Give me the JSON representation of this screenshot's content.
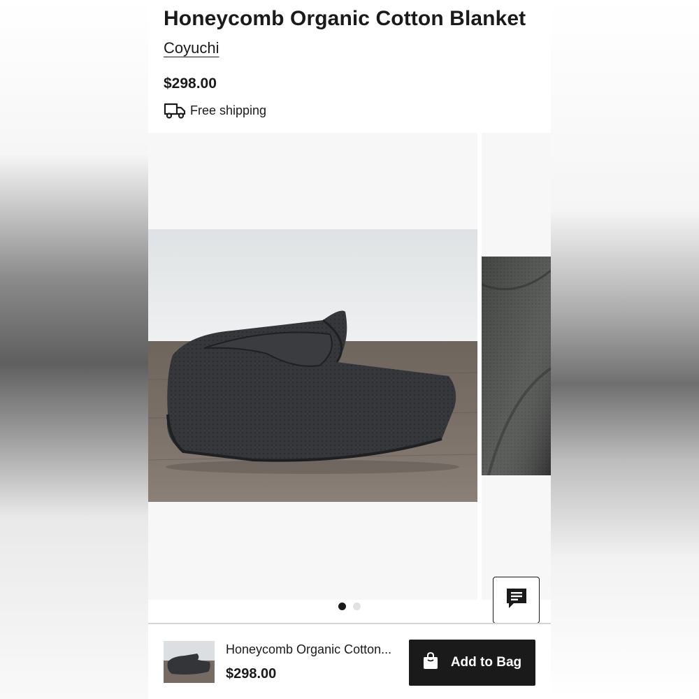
{
  "product": {
    "title": "Honeycomb Organic Cotton Blanket",
    "brand": "Coyuchi",
    "price": "$298.00",
    "shipping": "Free shipping"
  },
  "carousel": {
    "slide_count": 2,
    "active_index": 0
  },
  "sticky_bar": {
    "name": "Honeycomb Organic Cotton...",
    "price": "$298.00",
    "add_to_bag_label": "Add to Bag"
  },
  "icons": {
    "shipping": "truck-icon",
    "chat": "chat-icon",
    "bag": "shopping-bag-icon"
  },
  "colors": {
    "text": "#1a1a1a",
    "button_bg": "#1a1a1a",
    "button_text": "#ffffff",
    "dot_active": "#1a1a1a",
    "dot_inactive": "#e1e1e1"
  }
}
